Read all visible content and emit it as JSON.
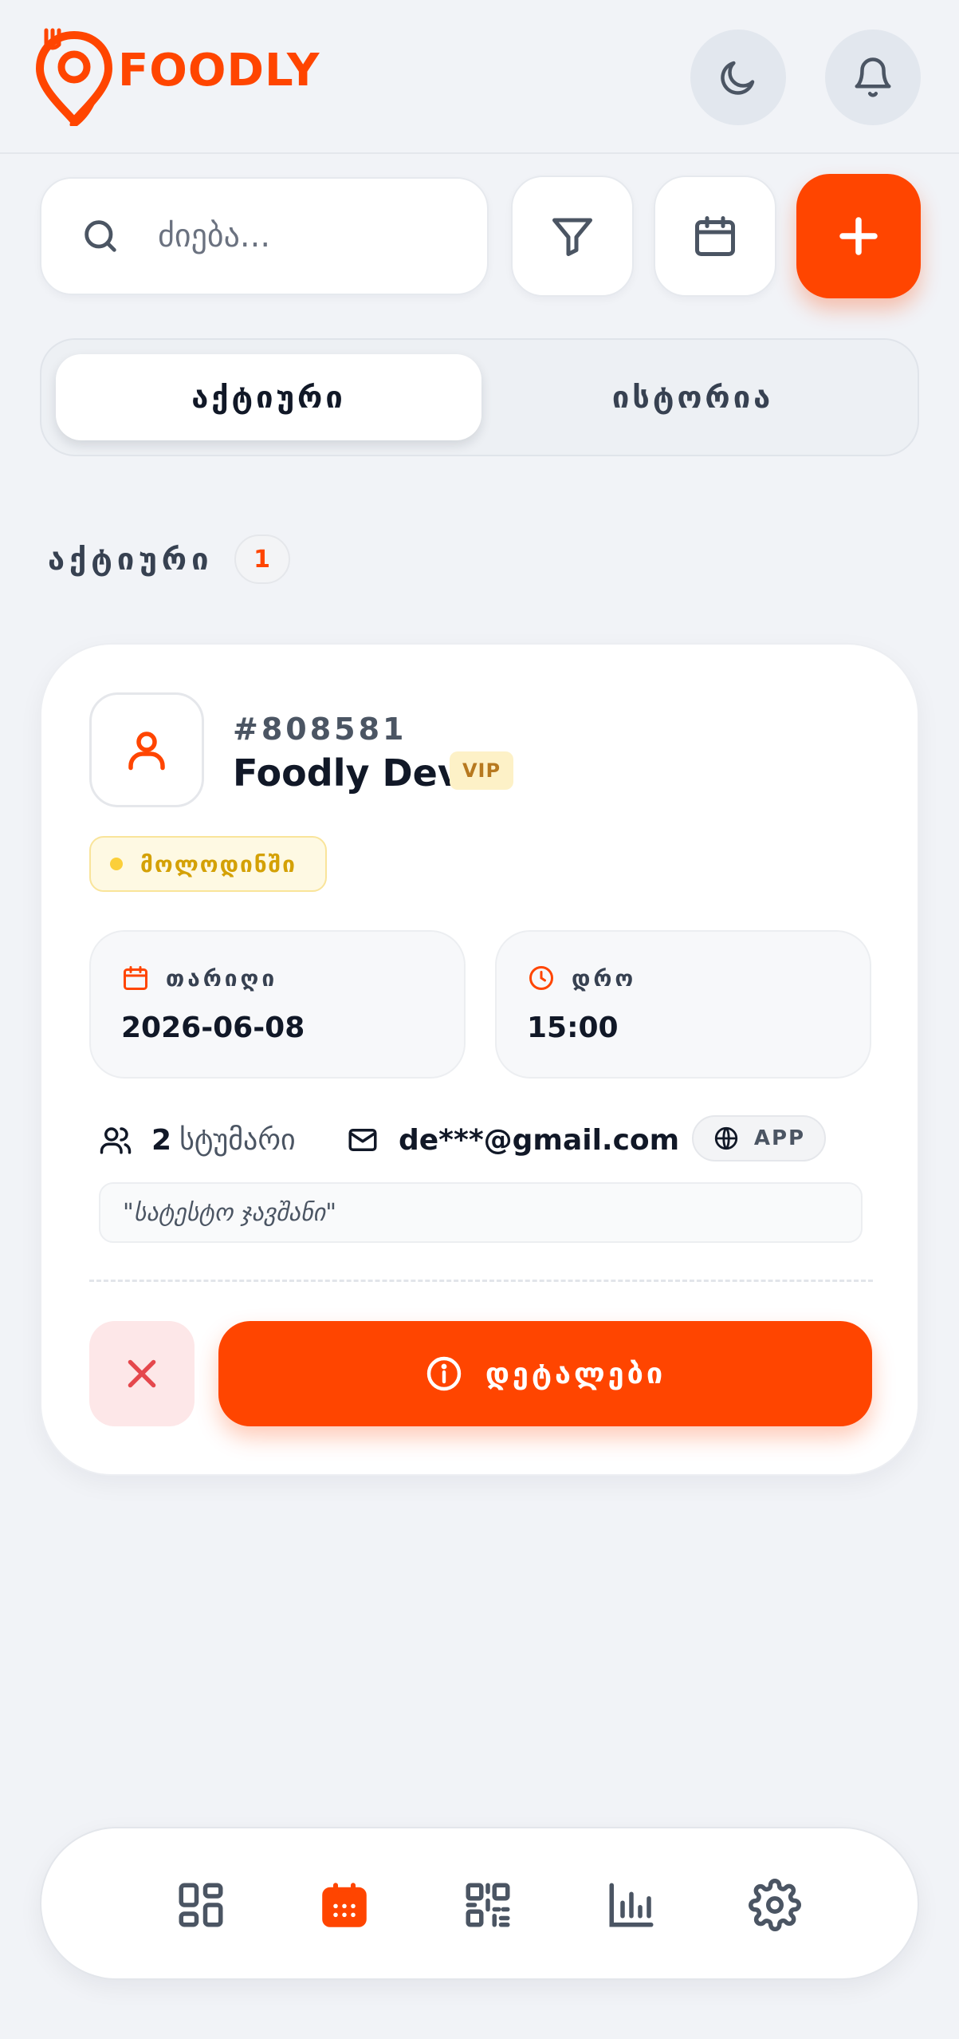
{
  "app": {
    "brand_name": "FOODLY",
    "brand_color": "#ff4500"
  },
  "header": {
    "theme_toggle_icon": "moon-icon",
    "notifications_icon": "bell-icon"
  },
  "toolbar": {
    "search_placeholder": "ძიება...",
    "filter_icon": "filter-icon",
    "calendar_icon": "calendar-icon",
    "add_icon": "plus-icon"
  },
  "tabs": [
    {
      "label": "აქტიური",
      "active": true
    },
    {
      "label": "ისტორია",
      "active": false
    }
  ],
  "section": {
    "title": "აქტიური",
    "count": "1"
  },
  "reservation": {
    "id": "#808581",
    "guest_name": "Foodly Dev",
    "tier_badge": "VIP",
    "status": "მოლოდინში",
    "date_label": "თარიღი",
    "date_value": "2026-06-08",
    "time_label": "დრო",
    "time_value": "15:00",
    "guest_count": "2",
    "guest_count_label": "სტუმარი",
    "email": "de***@gmail.com",
    "source": "APP",
    "note": "\"სატესტო ჯავშანი\"",
    "details_label": "დეტალები"
  },
  "bottom_nav": [
    {
      "icon": "dashboard-icon",
      "active": false
    },
    {
      "icon": "calendar-icon",
      "active": true
    },
    {
      "icon": "qr-code-icon",
      "active": false
    },
    {
      "icon": "bar-chart-icon",
      "active": false
    },
    {
      "icon": "settings-gear-icon",
      "active": false
    }
  ],
  "colors": {
    "accent": "#ff4500",
    "background": "#f1f3f7",
    "status_pending": "#d4a106",
    "danger": "#e5484d"
  }
}
